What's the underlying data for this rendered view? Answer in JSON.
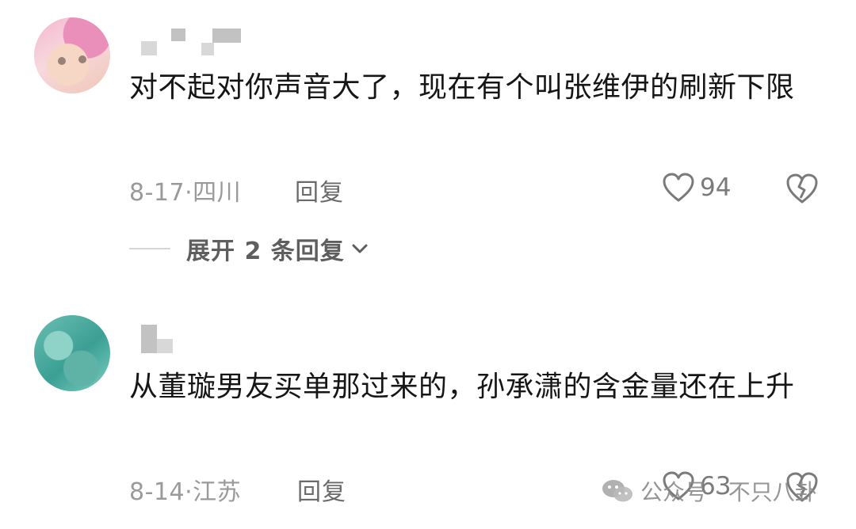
{
  "comments": [
    {
      "text": "对不起对你声音大了，现在有个叫张维伊的刷新下限",
      "date": "8-17",
      "location": "四川",
      "reply_label": "回复",
      "likes": "94",
      "expand_label": "展开 2 条回复"
    },
    {
      "text": "从董璇男友买单那过来的，孙承潇的含金量还在上升",
      "date": "8-14",
      "location": "江苏",
      "reply_label": "回复",
      "likes": "63"
    }
  ],
  "watermark": {
    "text": "公众号 · 不只八卦",
    "icon": "wechat-icon"
  },
  "colors": {
    "text": "#161616",
    "meta": "#9a9a9a",
    "icon": "#7a7a7a"
  }
}
